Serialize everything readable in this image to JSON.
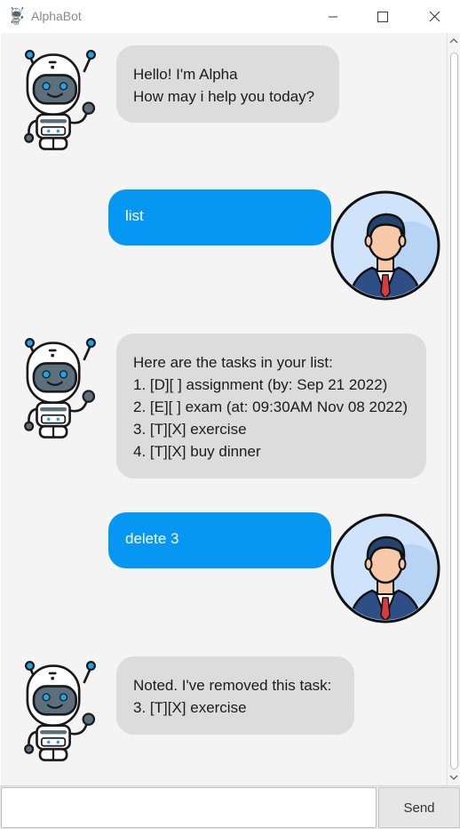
{
  "window": {
    "title": "AlphaBot",
    "icon": "robot-icon",
    "controls": [
      "minimize-icon",
      "maximize-icon",
      "close-icon"
    ]
  },
  "messages": [
    {
      "sender": "bot",
      "lines": [
        "Hello! I'm Alpha",
        "How may i help you today?"
      ]
    },
    {
      "sender": "user",
      "lines": [
        "list"
      ]
    },
    {
      "sender": "bot",
      "lines": [
        "Here are the tasks in your list:",
        "1. [D][ ] assignment (by: Sep 21 2022)",
        "2. [E][ ] exam (at: 09:30AM Nov 08 2022)",
        "3. [T][X] exercise",
        "4. [T][X] buy dinner"
      ]
    },
    {
      "sender": "user",
      "lines": [
        "delete 3"
      ]
    },
    {
      "sender": "bot",
      "lines": [
        "Noted. I've removed this task:",
        "3. [T][X] exercise"
      ]
    }
  ],
  "input": {
    "value": "",
    "placeholder": ""
  },
  "send_button": {
    "label": "Send"
  },
  "colors": {
    "user_bubble": "#0597f2",
    "bot_bubble": "#dcdcdc",
    "chat_background": "#f4f4f4",
    "robot_body": "#5b6f7d",
    "user_avatar_bg": "#cfe4fb",
    "user_suit": "#2d4f86"
  }
}
